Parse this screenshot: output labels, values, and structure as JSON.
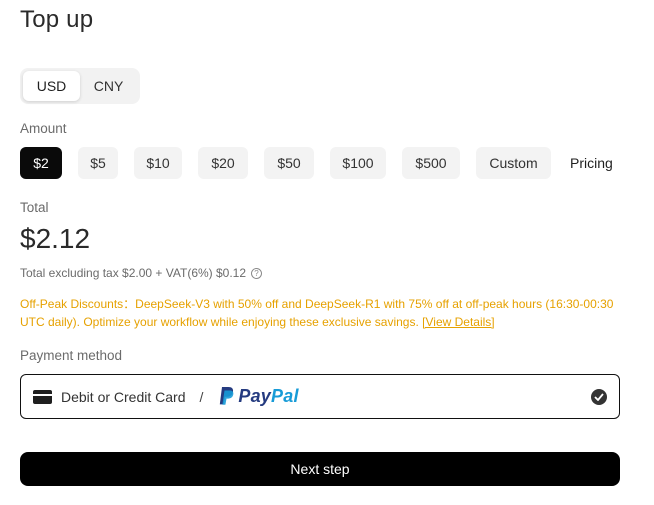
{
  "page": {
    "title": "Top up"
  },
  "currency": {
    "options": [
      "USD",
      "CNY"
    ],
    "selected": "USD"
  },
  "amount": {
    "label": "Amount",
    "options": [
      "$2",
      "$5",
      "$10",
      "$20",
      "$50",
      "$100",
      "$500",
      "Custom"
    ],
    "selected": "$2",
    "pricing_link": "Pricing"
  },
  "total": {
    "label": "Total",
    "value": "$2.12",
    "breakdown": "Total excluding tax $2.00 + VAT(6%) $0.12",
    "help_icon": "question-circle-icon"
  },
  "promo": {
    "text": "Off-Peak Discounts：DeepSeek-V3 with 50% off and DeepSeek-R1 with 75% off at off-peak hours (16:30-00:30 UTC daily). Optimize your workflow while enjoying these exclusive savings. ",
    "link": "[View Details]",
    "color": "#e6a100"
  },
  "payment": {
    "label": "Payment method",
    "card_text": "Debit or Credit Card",
    "separator": "/",
    "paypal_pay": "Pay",
    "paypal_pal": "Pal",
    "card_icon": "credit-card-icon",
    "check_icon": "check-circle-icon",
    "paypal_colors": {
      "pay": "#253b80",
      "pal": "#179bd7"
    }
  },
  "actions": {
    "next": "Next step"
  }
}
